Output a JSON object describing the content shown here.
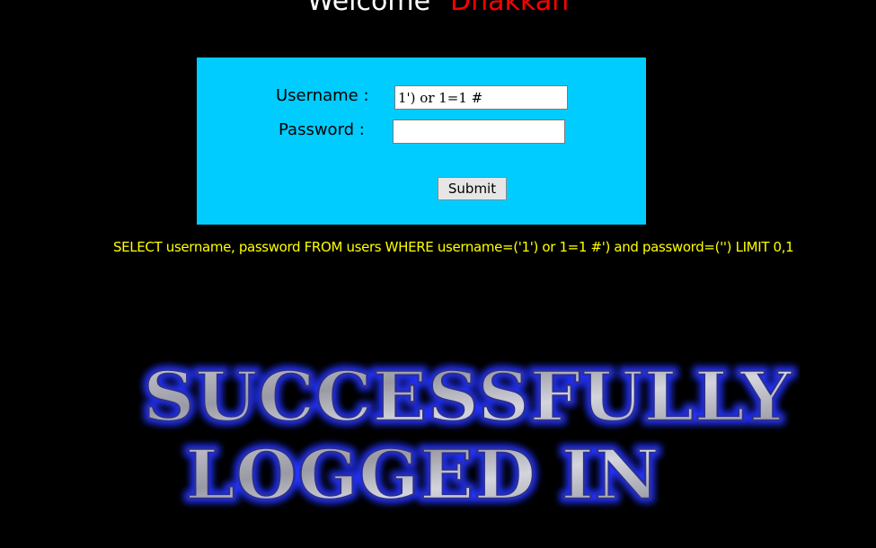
{
  "header": {
    "welcome_label": "Welcome",
    "user_name": "Dhakkan"
  },
  "login_form": {
    "username_label": "Username :",
    "username_value": "1') or 1=1 #",
    "password_label": "Password :",
    "password_value": "",
    "submit_label": "Submit"
  },
  "query_text": "SELECT username, password FROM users WHERE username=('1') or 1=1 #') and password=('') LIMIT 0,1",
  "banner": {
    "line1": "SUCCESSFULLY",
    "line2": "LOGGED IN"
  },
  "colors": {
    "background": "#000000",
    "form_background": "#00ccff",
    "query_text": "#ffff00",
    "user_name": "#ff0000",
    "banner_glow": "#2233ff"
  }
}
